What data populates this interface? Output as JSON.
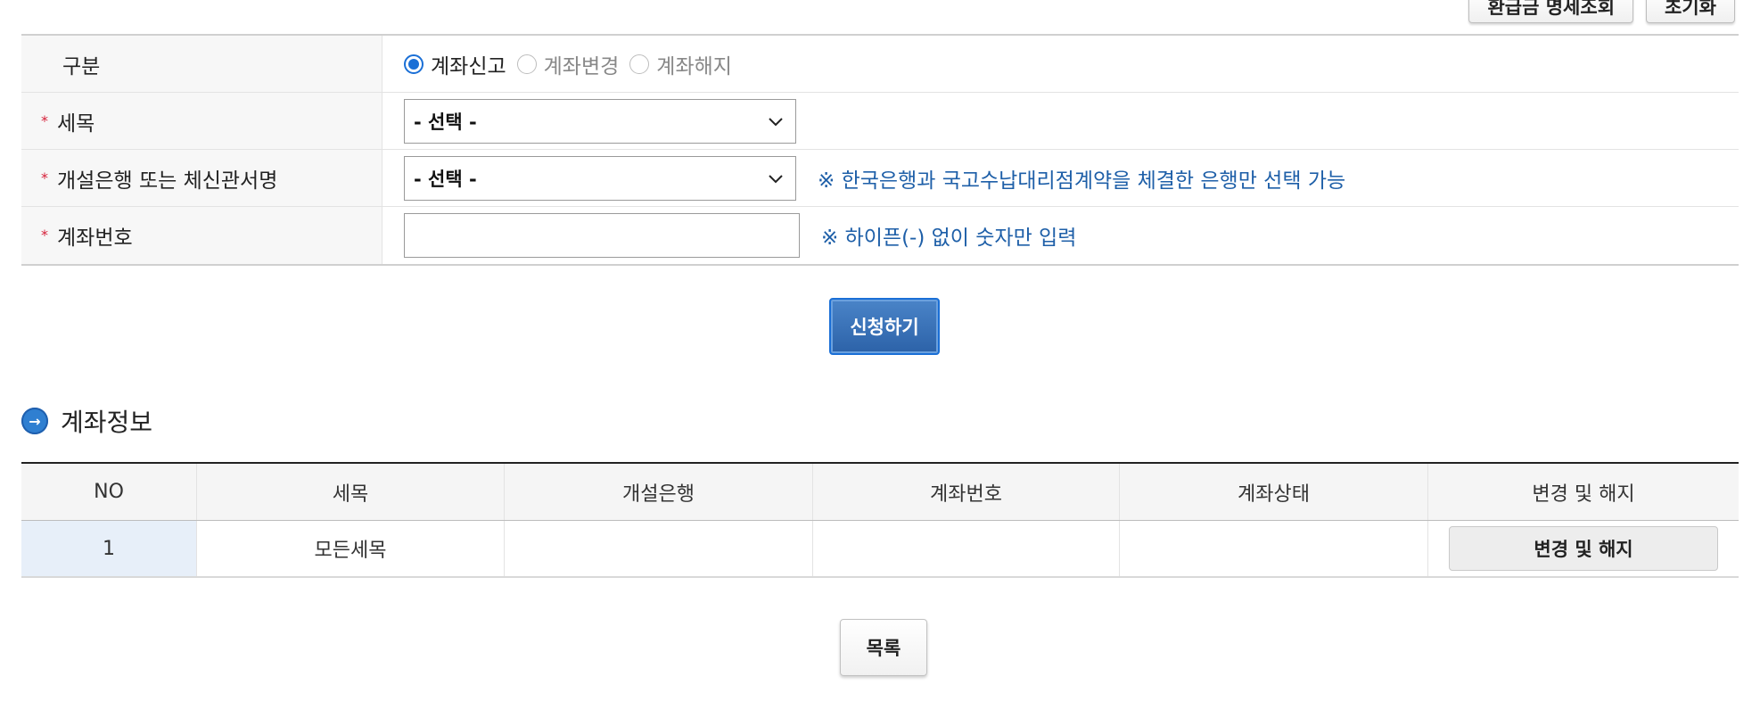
{
  "top_buttons": {
    "refund_lookup": "환급금 명세조회",
    "reset": "초기화"
  },
  "form": {
    "type_label": "구분",
    "type_options": [
      "계좌신고",
      "계좌변경",
      "계좌해지"
    ],
    "type_selected": "계좌신고",
    "tax_item_label": "세목",
    "tax_item_value": "- 선택 -",
    "bank_label": "개설은행 또는 체신관서명",
    "bank_value": "- 선택 -",
    "bank_hint": "※ 한국은행과 국고수납대리점계약을 체결한 은행만 선택 가능",
    "account_label": "계좌번호",
    "account_value": "",
    "account_hint": "※ 하이픈(-) 없이 숫자만 입력",
    "required_mark": "*"
  },
  "submit_label": "신청하기",
  "section_title": "계좌정보",
  "table": {
    "headers": [
      "NO",
      "세목",
      "개설은행",
      "계좌번호",
      "계좌상태",
      "변경 및 해지"
    ],
    "rows": [
      {
        "no": "1",
        "tax_item": "모든세목",
        "bank": "",
        "account": "",
        "status": "",
        "action": "변경 및 해지"
      }
    ]
  },
  "list_label": "목록",
  "colors": {
    "accent": "#1a6fd6",
    "hint": "#1e5fa8",
    "required": "#d6213a"
  },
  "icons": {
    "section": "arrow-right-circle-icon",
    "select": "chevron-down-icon"
  }
}
